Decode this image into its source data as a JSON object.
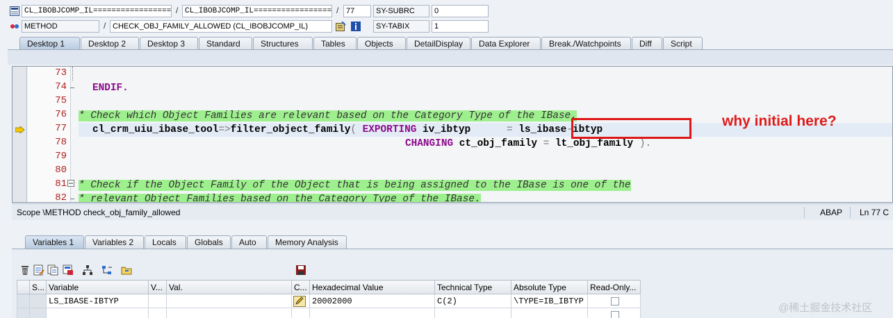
{
  "header": {
    "row1": {
      "program": "CL_IBOBJCOMP_IL=================",
      "include": "CL_IBOBJCOMP_IL=================",
      "line": "77",
      "sysfield_name": "SY-SUBRC",
      "sysfield_value": "0"
    },
    "row2": {
      "event_type": "METHOD",
      "event_name": "CHECK_OBJ_FAMILY_ALLOWED (CL_IBOBJCOMP_IL)",
      "sysfield_name": "SY-TABIX",
      "sysfield_value": "1"
    },
    "separator": "/"
  },
  "main_tabs": [
    "Desktop 1",
    "Desktop 2",
    "Desktop 3",
    "Standard",
    "Structures",
    "Tables",
    "Objects",
    "DetailDisplay",
    "Data Explorer",
    "Break./Watchpoints",
    "Diff",
    "Script"
  ],
  "editor": {
    "lines": [
      {
        "num": "73"
      },
      {
        "num": "74"
      },
      {
        "num": "75"
      },
      {
        "num": "76"
      },
      {
        "num": "77"
      },
      {
        "num": "78"
      },
      {
        "num": "79"
      },
      {
        "num": "80"
      },
      {
        "num": "81"
      },
      {
        "num": "82"
      }
    ],
    "code": {
      "l74": "ENDIF.",
      "l76": "* Check which Object Families are relevant based on the Category Type of the IBase.",
      "l77_obj": "cl_crm_uiu_ibase_tool",
      "l77_arrow": "=>",
      "l77_method": "filter_object_family",
      "l77_paren": "(",
      "l77_kw": "EXPORTING",
      "l77_param": "iv_ibtyp",
      "l77_eq": "=",
      "l77_val_a": "ls_ibase",
      "l77_dash": "-",
      "l77_val_b": "ibtyp",
      "l78_kw": "CHANGING",
      "l78_param": "ct_obj_family",
      "l78_eq": "=",
      "l78_val": "lt_obj_family",
      "l78_end": ").",
      "l81": "* Check if the Object Family of the Object that is being assigned to the IBase is one of the",
      "l82": "* relevant Object Families based on the Category Type of the IBase."
    }
  },
  "status": {
    "scope": "Scope \\METHOD check_obj_family_allowed",
    "language": "ABAP",
    "position": "Ln  77 C"
  },
  "var_tabs": [
    "Variables 1",
    "Variables 2",
    "Locals",
    "Globals",
    "Auto",
    "Memory Analysis"
  ],
  "var_table": {
    "columns": [
      "S...",
      "Variable",
      "V...",
      "Val.",
      "C...",
      "Hexadecimal Value",
      "Technical Type",
      "Absolute Type",
      "Read-Only..."
    ],
    "rows": [
      {
        "variable": "LS_IBASE-IBTYP",
        "value": "",
        "hex": "20002000",
        "tech_type": "C(2)",
        "abs_type": "\\TYPE=IB_IBTYP"
      }
    ]
  },
  "annotation": {
    "text": "why initial here?",
    "color": "#e01a1a"
  },
  "watermark": "@稀土掘金技术社区"
}
